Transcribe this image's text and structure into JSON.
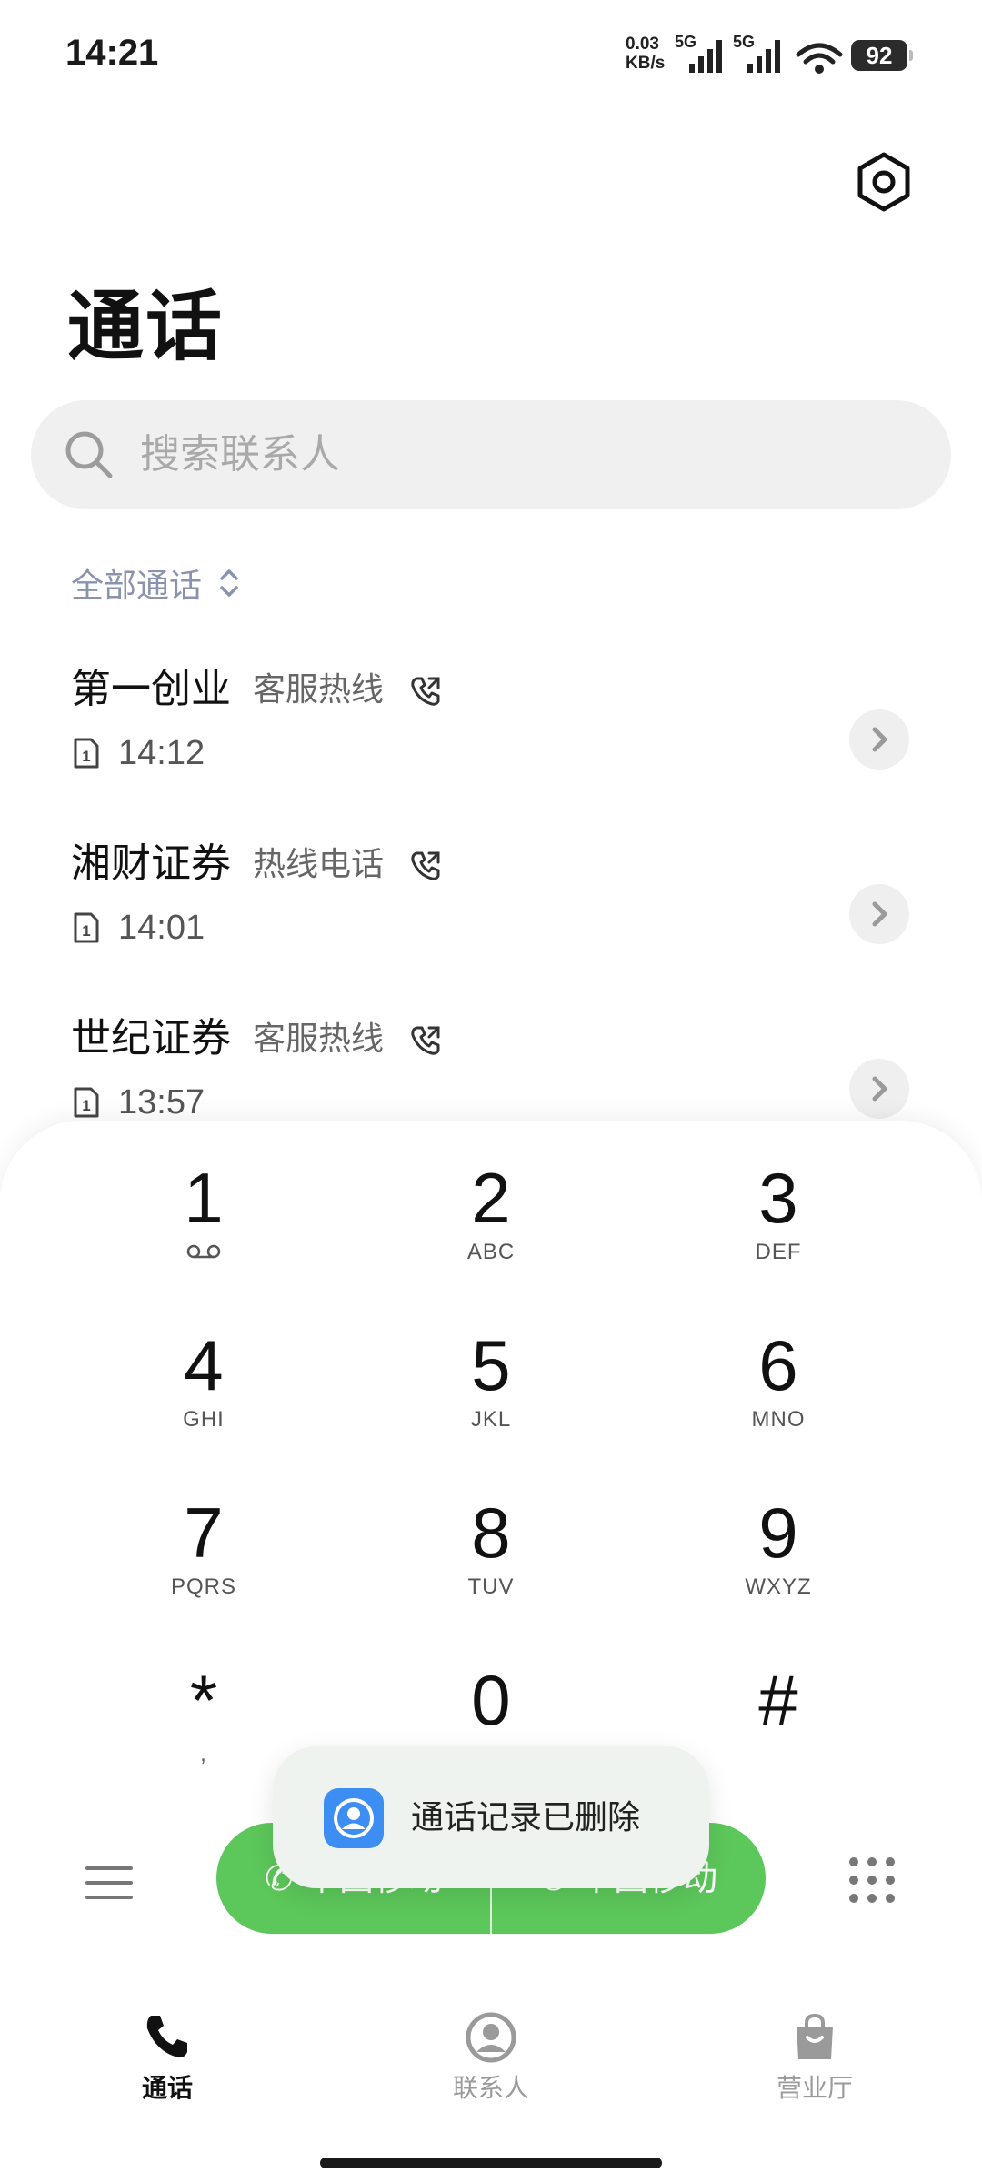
{
  "status_bar": {
    "time": "14:21",
    "net_speed_value": "0.03",
    "net_speed_unit": "KB/s",
    "sim1_network": "5G",
    "sim2_network": "5G",
    "battery": "92"
  },
  "header": {
    "title": "通话",
    "settings_icon": "hexagon-settings-icon"
  },
  "search": {
    "placeholder": "搜索联系人",
    "icon": "search-icon"
  },
  "filter": {
    "label": "全部通话"
  },
  "calls": [
    {
      "name": "第一创业",
      "tag": "客服热线",
      "time": "14:12",
      "sim": "1"
    },
    {
      "name": "湘财证券",
      "tag": "热线电话",
      "time": "14:01",
      "sim": "1"
    },
    {
      "name": "世纪证券",
      "tag": "客服热线",
      "time": "13:57",
      "sim": "1"
    }
  ],
  "dialpad": {
    "keys": [
      {
        "digit": "1",
        "sub": ""
      },
      {
        "digit": "2",
        "sub": "ABC"
      },
      {
        "digit": "3",
        "sub": "DEF"
      },
      {
        "digit": "4",
        "sub": "GHI"
      },
      {
        "digit": "5",
        "sub": "JKL"
      },
      {
        "digit": "6",
        "sub": "MNO"
      },
      {
        "digit": "7",
        "sub": "PQRS"
      },
      {
        "digit": "8",
        "sub": "TUV"
      },
      {
        "digit": "9",
        "sub": "WXYZ"
      },
      {
        "digit": "*",
        "sub": ","
      },
      {
        "digit": "0",
        "sub": ""
      },
      {
        "digit": "#",
        "sub": ""
      }
    ],
    "call_sim1_label": "中国移动",
    "call_sim2_label": "中国移动",
    "call_color": "#5cc75a"
  },
  "toast": {
    "text": "通话记录已删除"
  },
  "bottom_nav": {
    "items": [
      {
        "label": "通话",
        "icon": "phone-icon",
        "active": true
      },
      {
        "label": "联系人",
        "icon": "contact-icon",
        "active": false
      },
      {
        "label": "营业厅",
        "icon": "shopping-bag-icon",
        "active": false
      }
    ]
  }
}
